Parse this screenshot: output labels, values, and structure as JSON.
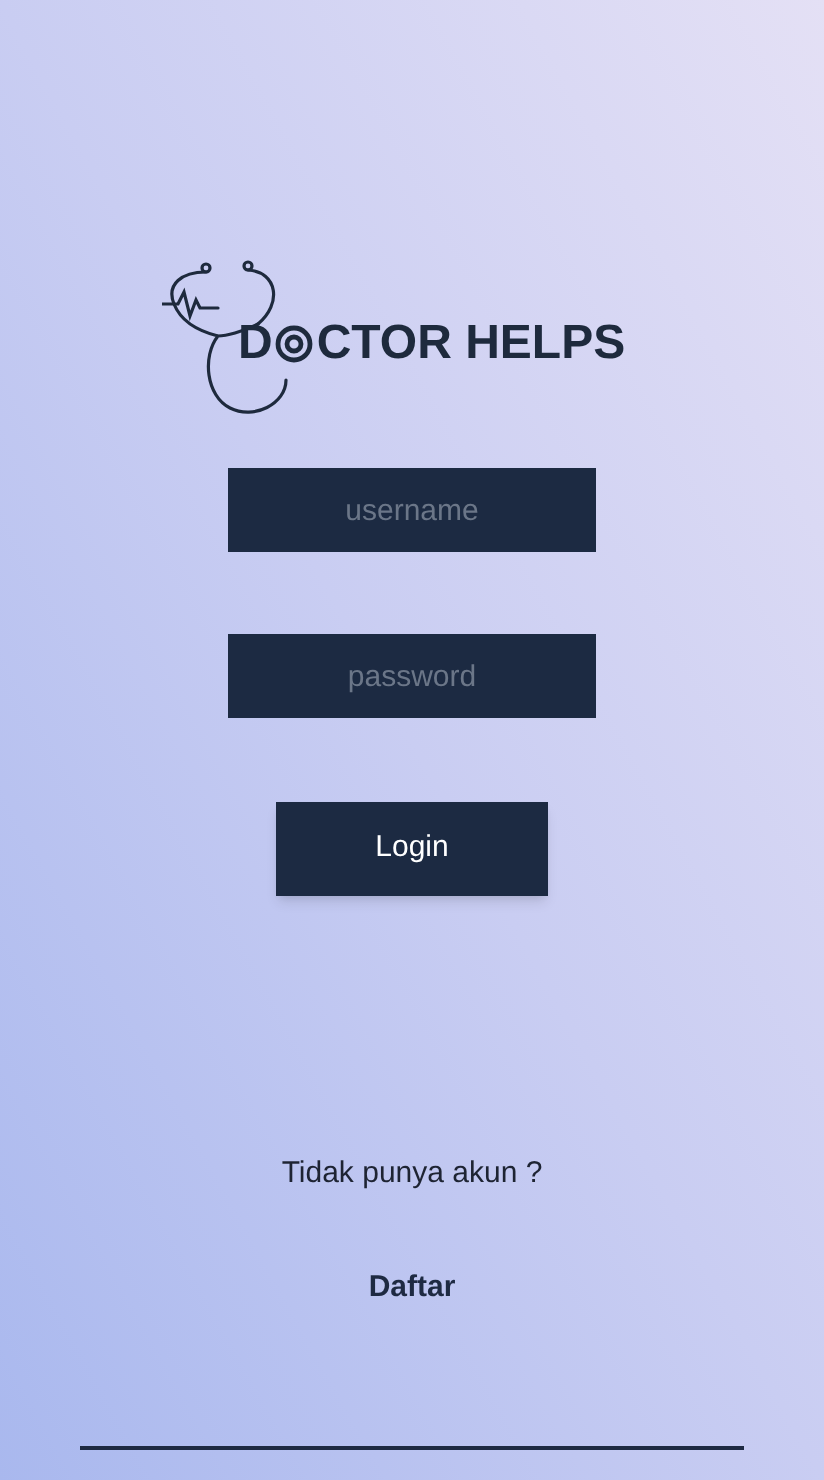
{
  "logo": {
    "text_before_ring": "D",
    "text_after_ring": "CTOR HELPS"
  },
  "fields": [
    {
      "placeholder": "username"
    },
    {
      "placeholder": "password"
    }
  ],
  "login_button": {
    "label": "Login"
  },
  "signup_prompt": "Tidak punya akun ?",
  "signup_link": "Daftar"
}
